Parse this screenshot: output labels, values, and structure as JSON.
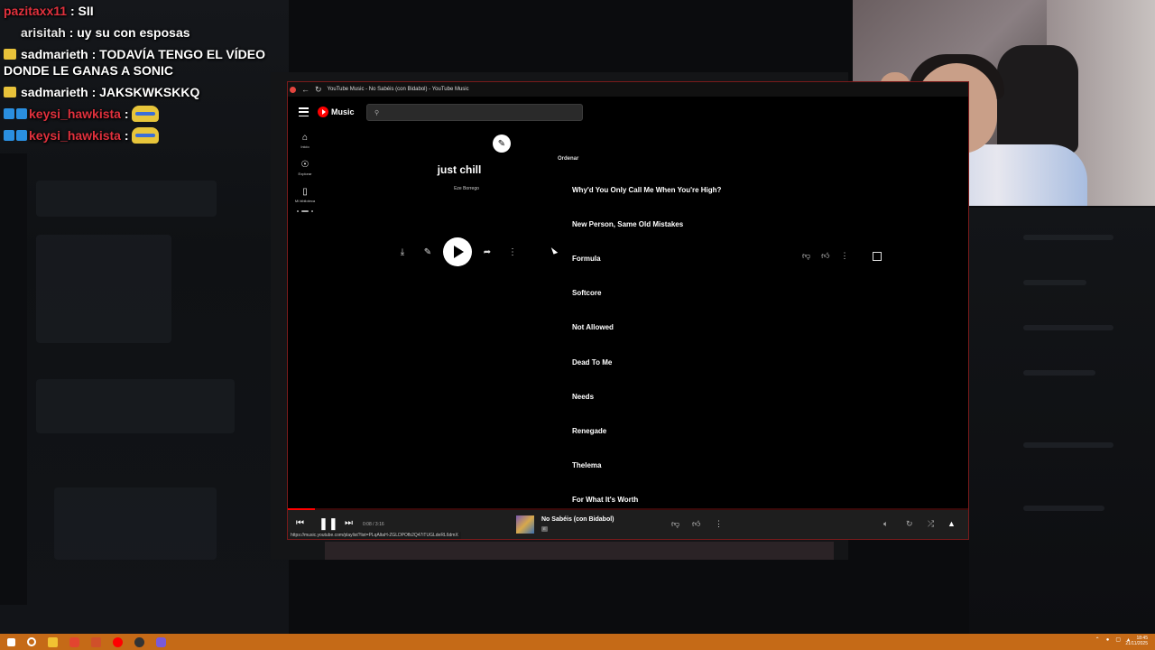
{
  "chat": [
    {
      "user": "pazitaxx11",
      "user_color": "red",
      "badge": "none",
      "message": " : SII"
    },
    {
      "user": "arisitah",
      "user_color": "plain",
      "badge": "none",
      "message": " : uy su con esposas"
    },
    {
      "user": "sadmarieth",
      "user_color": "white",
      "badge": "sub",
      "message": " : TODAVÍA TENGO EL VÍDEO DONDE LE GANAS A SONIC"
    },
    {
      "user": "sadmarieth",
      "user_color": "white",
      "badge": "sub",
      "message": " : JAKSKWKSKKQ"
    },
    {
      "user": "keysi_hawkista",
      "user_color": "red",
      "badge": "prime",
      "message": " : "
    },
    {
      "user": "keysi_hawkista",
      "user_color": "red",
      "badge": "prime",
      "message": " : "
    }
  ],
  "window": {
    "title": "YouTube Music - No Sabéis (con Bidabol) - YouTube Music",
    "logo_text": "Music"
  },
  "nav": [
    {
      "label": "Inicio",
      "icon": "home-icon"
    },
    {
      "label": "Explorar",
      "icon": "explore-icon"
    },
    {
      "label": "Mi biblioteca",
      "icon": "library-icon"
    }
  ],
  "playlist": {
    "title": "just chill",
    "owner": "Eze Borrego",
    "sort_label": "Ordenar"
  },
  "tracks": [
    "Why'd You Only Call Me When You're High?",
    "New Person, Same Old Mistakes",
    "Formula",
    "Softcore",
    "Not Allowed",
    "Dead To Me",
    "Needs",
    "Renegade",
    "Thelema",
    "For What It's Worth"
  ],
  "player": {
    "time": "0:08 / 3:16",
    "progress": 0.04,
    "song": "No Sabéis (con Bidabol)",
    "explicit": "E",
    "url": "https://music.youtube.com/playlist?list=PLqAltaH-ZGLDPOfb2Q47iTUGLdeRL6dmX"
  },
  "clock": {
    "time": "18:45",
    "date": "21/11/2025"
  },
  "colors": {
    "accent": "#ff0000",
    "taskbar": "#c56a17"
  }
}
